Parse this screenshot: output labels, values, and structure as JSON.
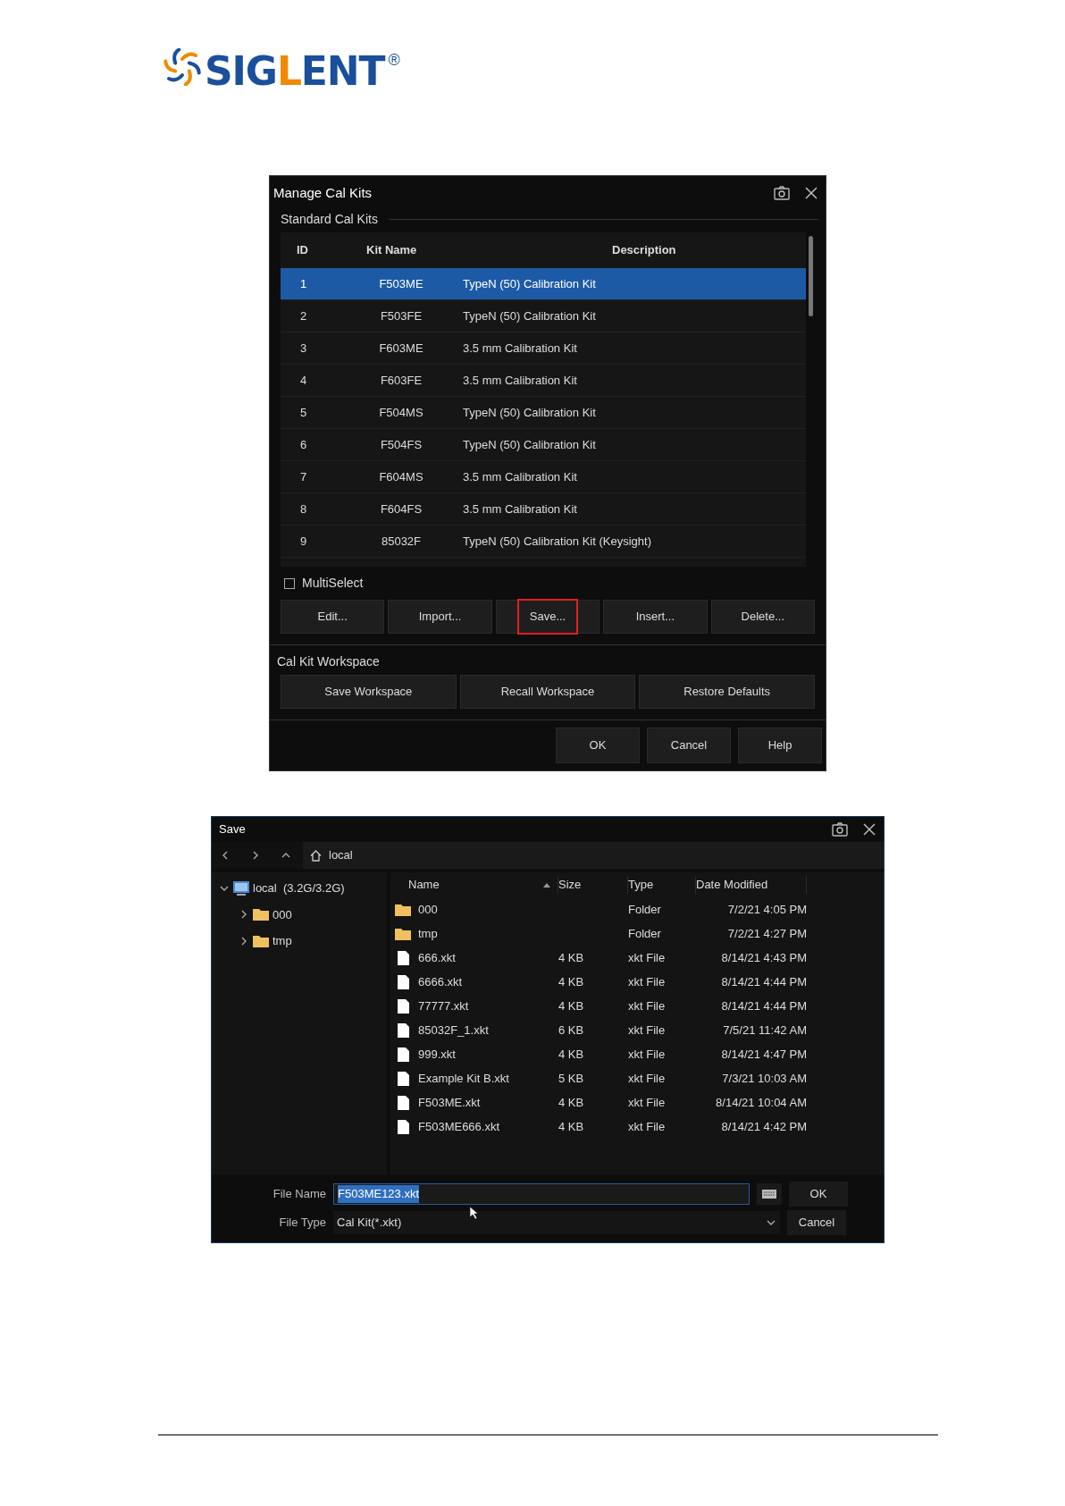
{
  "logo": {
    "parts": [
      {
        "text": "SIG",
        "accent": false
      },
      {
        "text": "L",
        "accent": true
      },
      {
        "text": "ENT",
        "accent": false
      }
    ],
    "mark": "®"
  },
  "cal_dialog": {
    "title": "Manage Cal Kits",
    "group_title": "Standard Cal Kits",
    "table": {
      "columns": [
        "ID",
        "Kit Name",
        "Description"
      ],
      "rows": [
        {
          "id": "1",
          "kit_name": "F503ME",
          "description": "TypeN (50) Calibration Kit",
          "selected": true
        },
        {
          "id": "2",
          "kit_name": "F503FE",
          "description": "TypeN (50) Calibration Kit",
          "selected": false
        },
        {
          "id": "3",
          "kit_name": "F603ME",
          "description": "3.5 mm Calibration Kit",
          "selected": false
        },
        {
          "id": "4",
          "kit_name": "F603FE",
          "description": "3.5 mm Calibration Kit",
          "selected": false
        },
        {
          "id": "5",
          "kit_name": "F504MS",
          "description": "TypeN (50) Calibration Kit",
          "selected": false
        },
        {
          "id": "6",
          "kit_name": "F504FS",
          "description": "TypeN (50) Calibration Kit",
          "selected": false
        },
        {
          "id": "7",
          "kit_name": "F604MS",
          "description": "3.5 mm Calibration Kit",
          "selected": false
        },
        {
          "id": "8",
          "kit_name": "F604FS",
          "description": "3.5 mm Calibration Kit",
          "selected": false
        },
        {
          "id": "9",
          "kit_name": "85032F",
          "description": "TypeN (50) Calibration Kit (Keysight)",
          "selected": false
        }
      ]
    },
    "multiselect": {
      "label": "MultiSelect",
      "checked": false
    },
    "buttons": [
      {
        "label": "Edit...",
        "highlighted": false
      },
      {
        "label": "Import...",
        "highlighted": false
      },
      {
        "label": "Save...",
        "highlighted": true
      },
      {
        "label": "Insert...",
        "highlighted": false
      },
      {
        "label": "Delete...",
        "highlighted": false
      }
    ],
    "workspace": {
      "title": "Cal Kit Workspace",
      "buttons": [
        "Save Workspace",
        "Recall Workspace",
        "Restore Defaults"
      ]
    },
    "footer_buttons": [
      "OK",
      "Cancel",
      "Help"
    ]
  },
  "save_dialog": {
    "title": "Save",
    "path": "local",
    "tree": {
      "label": "local  (3.2G/3.2G)",
      "expanded": true,
      "children": [
        {
          "label": "000",
          "expanded": false
        },
        {
          "label": "tmp",
          "expanded": false
        }
      ]
    },
    "file_list": {
      "columns": [
        {
          "label": "Name",
          "sorted": true
        },
        {
          "label": "Size",
          "sorted": false
        },
        {
          "label": "Type",
          "sorted": false
        },
        {
          "label": "Date Modified",
          "sorted": false
        }
      ],
      "rows": [
        {
          "kind": "folder",
          "name": "000",
          "size": "",
          "type": "Folder",
          "date": "7/2/21 4:05 PM"
        },
        {
          "kind": "folder",
          "name": "tmp",
          "size": "",
          "type": "Folder",
          "date": "7/2/21 4:27 PM"
        },
        {
          "kind": "file",
          "name": "666.xkt",
          "size": "4 KB",
          "type": "xkt File",
          "date": "8/14/21 4:43 PM"
        },
        {
          "kind": "file",
          "name": "6666.xkt",
          "size": "4 KB",
          "type": "xkt File",
          "date": "8/14/21 4:44 PM"
        },
        {
          "kind": "file",
          "name": "77777.xkt",
          "size": "4 KB",
          "type": "xkt File",
          "date": "8/14/21 4:44 PM"
        },
        {
          "kind": "file",
          "name": "85032F_1.xkt",
          "size": "6 KB",
          "type": "xkt File",
          "date": "7/5/21 11:42 AM"
        },
        {
          "kind": "file",
          "name": "999.xkt",
          "size": "4 KB",
          "type": "xkt File",
          "date": "8/14/21 4:47 PM"
        },
        {
          "kind": "file",
          "name": "Example Kit B.xkt",
          "size": "5 KB",
          "type": "xkt File",
          "date": "7/3/21 10:03 AM"
        },
        {
          "kind": "file",
          "name": "F503ME.xkt",
          "size": "4 KB",
          "type": "xkt File",
          "date": "8/14/21 10:04 AM"
        },
        {
          "kind": "file",
          "name": "F503ME666.xkt",
          "size": "4 KB",
          "type": "xkt File",
          "date": "8/14/21 4:42 PM"
        }
      ]
    },
    "file_name": {
      "label": "File Name",
      "value": "F503ME123.xkt",
      "text_selected": true
    },
    "file_type": {
      "label": "File Type",
      "value": "Cal Kit(*.xkt)"
    },
    "buttons": [
      "OK",
      "Cancel"
    ]
  }
}
